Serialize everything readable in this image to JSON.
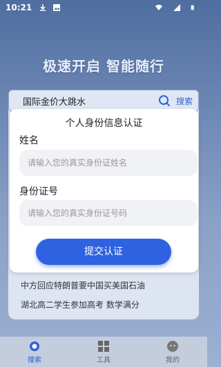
{
  "status_bar": {
    "time": "10:21"
  },
  "hero": {
    "title": "极速开启 智能随行"
  },
  "search": {
    "text": "国际金价大跳水",
    "button_label": "搜索"
  },
  "news": {
    "items": [
      "中方回应特朗普要中国买美国石油",
      "湖北高二学生参加高考 数学满分"
    ]
  },
  "modal": {
    "title": "个人身份信息认证",
    "name_label": "姓名",
    "name_placeholder": "请输入您的真实身份证姓名",
    "id_label": "身份证号",
    "id_placeholder": "请输入您的真实身份证号码",
    "submit_label": "提交认证"
  },
  "tabbar": {
    "tabs": [
      {
        "label": "搜索",
        "icon": "search-tab-icon",
        "active": true
      },
      {
        "label": "工具",
        "icon": "tools-icon",
        "active": false
      },
      {
        "label": "我的",
        "icon": "profile-icon",
        "active": false
      }
    ]
  },
  "colors": {
    "accent": "#2f62e0",
    "background_top": "#4f6d9f",
    "background_bottom": "#9bb0d2"
  }
}
